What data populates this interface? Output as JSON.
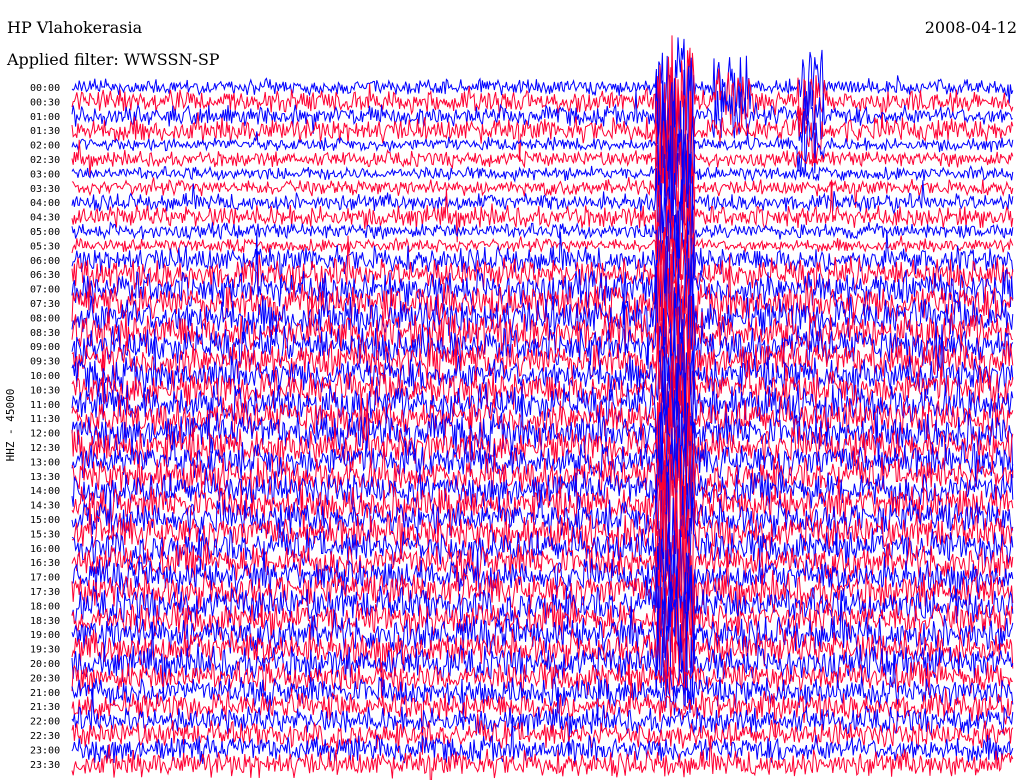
{
  "header": {
    "station": "HP Vlahokerasia",
    "filter": "Applied filter: WWSSN-SP",
    "date": "2008-04-12"
  },
  "chart_data": {
    "type": "line",
    "ylabel": "HHZ - 45000",
    "row_labels": [
      "00:00",
      "00:30",
      "01:00",
      "01:30",
      "02:00",
      "02:30",
      "03:00",
      "03:30",
      "04:00",
      "04:30",
      "05:00",
      "05:30",
      "06:00",
      "06:30",
      "07:00",
      "07:30",
      "08:00",
      "08:30",
      "09:00",
      "09:30",
      "10:00",
      "10:30",
      "11:00",
      "11:30",
      "12:00",
      "12:30",
      "13:00",
      "13:30",
      "14:00",
      "14:30",
      "15:00",
      "15:30",
      "16:00",
      "16:30",
      "17:00",
      "17:30",
      "18:00",
      "18:30",
      "19:00",
      "19:30",
      "20:00",
      "20:30",
      "21:00",
      "21:30",
      "22:00",
      "22:30",
      "23:00",
      "23:30"
    ],
    "colors": {
      "even": "#0000ff",
      "odd": "#ff0033"
    },
    "amplitude_per_row": [
      0.35,
      0.5,
      0.45,
      0.55,
      0.3,
      0.35,
      0.3,
      0.35,
      0.4,
      0.5,
      0.35,
      0.3,
      0.6,
      0.7,
      0.8,
      0.85,
      0.9,
      0.9,
      0.85,
      0.85,
      0.8,
      0.85,
      0.85,
      0.85,
      0.85,
      0.85,
      0.8,
      0.8,
      0.8,
      0.8,
      0.8,
      0.8,
      0.8,
      0.8,
      0.75,
      0.8,
      0.8,
      0.8,
      0.8,
      0.8,
      0.75,
      0.7,
      0.65,
      0.65,
      0.6,
      0.6,
      0.6,
      0.6
    ],
    "events": [
      {
        "name": "large-event",
        "x_start": 0.62,
        "x_end": 0.66,
        "row_start": 0,
        "row_end": 40
      },
      {
        "name": "event-burst-1",
        "x_start": 0.68,
        "x_end": 0.72,
        "row_start": 0,
        "row_end": 2
      },
      {
        "name": "event-burst-2",
        "x_start": 0.77,
        "x_end": 0.8,
        "row_start": 0,
        "row_end": 4
      }
    ]
  }
}
